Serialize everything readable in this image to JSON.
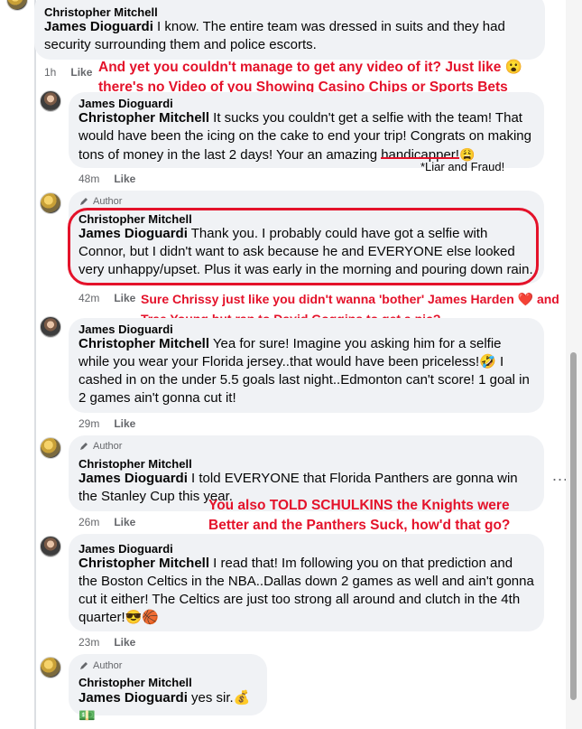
{
  "comments": [
    {
      "id": "c1",
      "name": "Christopher Mitchell",
      "reply_to": "James Dioguardi",
      "text": " I know. The entire team was dressed in suits and they had security surrounding them and police escorts.",
      "time": "1h",
      "like_label": "Like"
    },
    {
      "id": "c2",
      "name": "James Dioguardi",
      "reply_to": "Christopher Mitchell",
      "text_part1": " It sucks you couldn't get a selfie with the team! That would have been the icing on the cake to end your trip! Congrats on making tons of money in the last 2 days! Your an amazing ",
      "struck_word": "handicapper!",
      "emoji": "😩",
      "time": "48m",
      "like_label": "Like"
    },
    {
      "id": "c3",
      "author_tag": "Author",
      "name": "Christopher Mitchell",
      "reply_to": "James Dioguardi",
      "text": " Thank you. I probably could have got a selfie with Connor, but I didn't want to ask because he and EVERYONE else looked very unhappy/upset. Plus it was early in the morning and pouring down rain.",
      "time": "42m",
      "like_label": "Like"
    },
    {
      "id": "c4",
      "name": "James Dioguardi",
      "reply_to": "Christopher Mitchell",
      "text": " Yea for sure! Imagine you asking him for a selfie while you wear your Florida jersey..that would have been priceless!🤣 I cashed in on the under 5.5 goals last night..Edmonton can't score! 1 goal in 2 games ain't gonna cut it!",
      "time": "29m",
      "like_label": "Like"
    },
    {
      "id": "c5",
      "author_tag": "Author",
      "name": "Christopher Mitchell",
      "reply_to": "James Dioguardi",
      "text": " I told EVERYONE that Florida Panthers are gonna win the Stanley Cup this year.",
      "time": "26m",
      "like_label": "Like"
    },
    {
      "id": "c6",
      "name": "James Dioguardi",
      "reply_to": "Christopher Mitchell",
      "text": " I read that! Im following you on that prediction and the Boston Celtics in the NBA..Dallas down 2 games as well and ain't gonna cut it either! The Celtics are just too strong all around and clutch in the 4th quarter!😎🏀",
      "time": "23m",
      "like_label": "Like"
    },
    {
      "id": "c7",
      "author_tag": "Author",
      "name": "Christopher Mitchell",
      "reply_to": "James Dioguardi",
      "text": " yes sir.💰💵"
    }
  ],
  "annotations": {
    "a1": "And yet you couldn't manage to get any video of it? Just like 😮 there's no Video of you Showing Casino Chips or Sports Bets",
    "a2": "*Liar and Fraud!",
    "a3": "Sure Chrissy just like you didn't wanna 'bother' James Harden ❤️ and Trae Young but ran to David Goggins to get a pic?",
    "a4": "You also TOLD SCHULKINS the Knights were Better and the Panthers Suck, how'd that go?"
  },
  "more_options": "...",
  "colors": {
    "bubble": "#f0f2f5",
    "annotation_red": "#e4122a",
    "meta_gray": "#65676b"
  }
}
